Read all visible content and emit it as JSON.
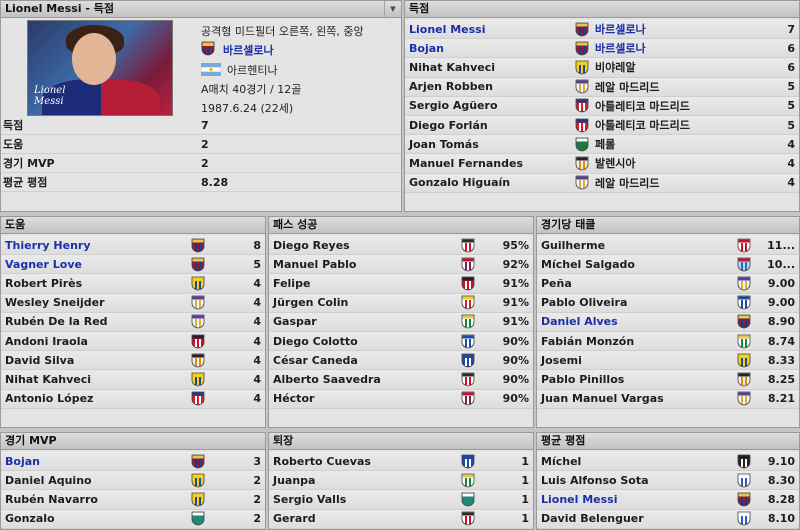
{
  "colors": {
    "link": "#1b2fa8",
    "panel_bg": "#e4e4e4",
    "header_bg": "#cccccc"
  },
  "profile": {
    "title": "Lionel Messi - 득점",
    "photo_caption_line1": "Lionel",
    "photo_caption_line2": "Messi",
    "position": "공격형 미드필더 오른쪽, 왼쪽, 중앙",
    "club": "바르셀로나",
    "nation": "아르헨티나",
    "caps": "A매치 40경기 / 12골",
    "birth": "1987.6.24 (22세)",
    "stats": [
      {
        "label": "득점",
        "value": "7"
      },
      {
        "label": "도움",
        "value": "2"
      },
      {
        "label": "경기 MVP",
        "value": "2"
      },
      {
        "label": "평균 평점",
        "value": "8.28"
      }
    ]
  },
  "scorers": {
    "title": "득점",
    "rows": [
      {
        "name": "Lionel Messi",
        "link": true,
        "crest": "barcelona-crest",
        "club": "바르셀로나",
        "club_link": true,
        "value": "7"
      },
      {
        "name": "Bojan",
        "link": true,
        "crest": "barcelona-crest",
        "club": "바르셀로나",
        "club_link": true,
        "value": "6"
      },
      {
        "name": "Nihat Kahveci",
        "link": false,
        "crest": "villarreal-crest",
        "club": "비야레알",
        "club_link": false,
        "value": "6"
      },
      {
        "name": "Arjen Robben",
        "link": false,
        "crest": "real-madrid-crest",
        "club": "레알 마드리드",
        "club_link": false,
        "value": "5"
      },
      {
        "name": "Sergio Agüero",
        "link": false,
        "crest": "atletico-crest",
        "club": "아틀레티코 마드리드",
        "club_link": false,
        "value": "5"
      },
      {
        "name": "Diego Forlán",
        "link": false,
        "crest": "atletico-crest",
        "club": "아틀레티코 마드리드",
        "club_link": false,
        "value": "5"
      },
      {
        "name": "Joan Tomás",
        "link": false,
        "crest": "ferrol-crest",
        "club": "페롤",
        "club_link": false,
        "value": "4"
      },
      {
        "name": "Manuel Fernandes",
        "link": false,
        "crest": "valencia-crest",
        "club": "발렌시아",
        "club_link": false,
        "value": "4"
      },
      {
        "name": "Gonzalo Higuaín",
        "link": false,
        "crest": "real-madrid-crest",
        "club": "레알 마드리드",
        "club_link": false,
        "value": "4"
      }
    ]
  },
  "assists": {
    "title": "도움",
    "rows": [
      {
        "name": "Thierry Henry",
        "link": true,
        "crest": "barcelona-crest",
        "value": "8"
      },
      {
        "name": "Vagner Love",
        "link": true,
        "crest": "barcelona-crest",
        "value": "5"
      },
      {
        "name": "Robert Pirès",
        "link": false,
        "crest": "villarreal-crest",
        "value": "4"
      },
      {
        "name": "Wesley Sneijder",
        "link": false,
        "crest": "real-madrid-crest",
        "value": "4"
      },
      {
        "name": "Rubén De la Red",
        "link": false,
        "crest": "real-madrid-crest",
        "value": "4"
      },
      {
        "name": "Andoni Iraola",
        "link": false,
        "crest": "athletic-crest",
        "value": "4"
      },
      {
        "name": "David Silva",
        "link": false,
        "crest": "valencia-crest",
        "value": "4"
      },
      {
        "name": "Nihat Kahveci",
        "link": false,
        "crest": "villarreal-crest",
        "value": "4"
      },
      {
        "name": "Antonio López",
        "link": false,
        "crest": "atletico-crest",
        "value": "4"
      }
    ]
  },
  "passes": {
    "title": "패스 성공",
    "rows": [
      {
        "name": "Diego Reyes",
        "link": false,
        "crest": "bilbao-crest",
        "value": "95%"
      },
      {
        "name": "Manuel Pablo",
        "link": false,
        "crest": "deportivo-crest",
        "value": "92%"
      },
      {
        "name": "Felipe",
        "link": false,
        "crest": "athletic-crest",
        "value": "91%"
      },
      {
        "name": "Jürgen Colin",
        "link": false,
        "crest": "gijon-crest",
        "value": "91%"
      },
      {
        "name": "Gaspar",
        "link": false,
        "crest": "betis-crest",
        "value": "91%"
      },
      {
        "name": "Diego Colotto",
        "link": false,
        "crest": "espanyol-crest",
        "value": "90%"
      },
      {
        "name": "César Caneda",
        "link": false,
        "crest": "alaves-crest",
        "value": "90%"
      },
      {
        "name": "Alberto Saavedra",
        "link": false,
        "crest": "bilbao-crest",
        "value": "90%"
      },
      {
        "name": "Héctor",
        "link": false,
        "crest": "deportivo-crest",
        "value": "90%"
      }
    ]
  },
  "tackles": {
    "title": "경기당 태클",
    "rows": [
      {
        "name": "Guilherme",
        "link": false,
        "crest": "sevilla-crest",
        "value": "11..."
      },
      {
        "name": "Míchel Salgado",
        "link": false,
        "crest": "celta-crest",
        "value": "10..."
      },
      {
        "name": "Peña",
        "link": false,
        "crest": "real-madrid-crest",
        "value": "9.00"
      },
      {
        "name": "Pablo Oliveira",
        "link": false,
        "crest": "espanyol-crest",
        "value": "9.00"
      },
      {
        "name": "Daniel Alves",
        "link": true,
        "crest": "barcelona-crest",
        "value": "8.90"
      },
      {
        "name": "Fabián Monzón",
        "link": false,
        "crest": "betis-crest",
        "value": "8.74"
      },
      {
        "name": "Josemi",
        "link": false,
        "crest": "villarreal-crest",
        "value": "8.33"
      },
      {
        "name": "Pablo Pinillos",
        "link": false,
        "crest": "valencia-crest",
        "value": "8.25"
      },
      {
        "name": "Juan Manuel Vargas",
        "link": false,
        "crest": "real-madrid-crest",
        "value": "8.21"
      }
    ]
  },
  "mvp": {
    "title": "경기 MVP",
    "rows": [
      {
        "name": "Bojan",
        "link": true,
        "crest": "barcelona-crest",
        "value": "3"
      },
      {
        "name": "Daniel Aquino",
        "link": false,
        "crest": "cadiz-crest",
        "value": "2"
      },
      {
        "name": "Rubén Navarro",
        "link": false,
        "crest": "villarreal-crest",
        "value": "2"
      },
      {
        "name": "Gonzalo",
        "link": false,
        "crest": "racing-crest",
        "value": "2"
      }
    ]
  },
  "sent_off": {
    "title": "퇴장",
    "rows": [
      {
        "name": "Roberto Cuevas",
        "link": false,
        "crest": "alaves-crest",
        "value": "1"
      },
      {
        "name": "Juanpa",
        "link": false,
        "crest": "betis-crest",
        "value": "1"
      },
      {
        "name": "Sergio Valls",
        "link": false,
        "crest": "racing-crest",
        "value": "1"
      },
      {
        "name": "Gerard",
        "link": false,
        "crest": "bilbao-crest",
        "value": "1"
      }
    ]
  },
  "avg_rating": {
    "title": "평균 평점",
    "rows": [
      {
        "name": "Míchel",
        "link": false,
        "crest": "dark-shield-crest",
        "value": "9.10"
      },
      {
        "name": "Luis Alfonso Sota",
        "link": false,
        "crest": "white-shield-crest",
        "value": "8.30"
      },
      {
        "name": "Lionel Messi",
        "link": true,
        "crest": "barcelona-crest",
        "value": "8.28"
      },
      {
        "name": "David Belenguer",
        "link": false,
        "crest": "white-shield-crest",
        "value": "8.10"
      }
    ]
  }
}
